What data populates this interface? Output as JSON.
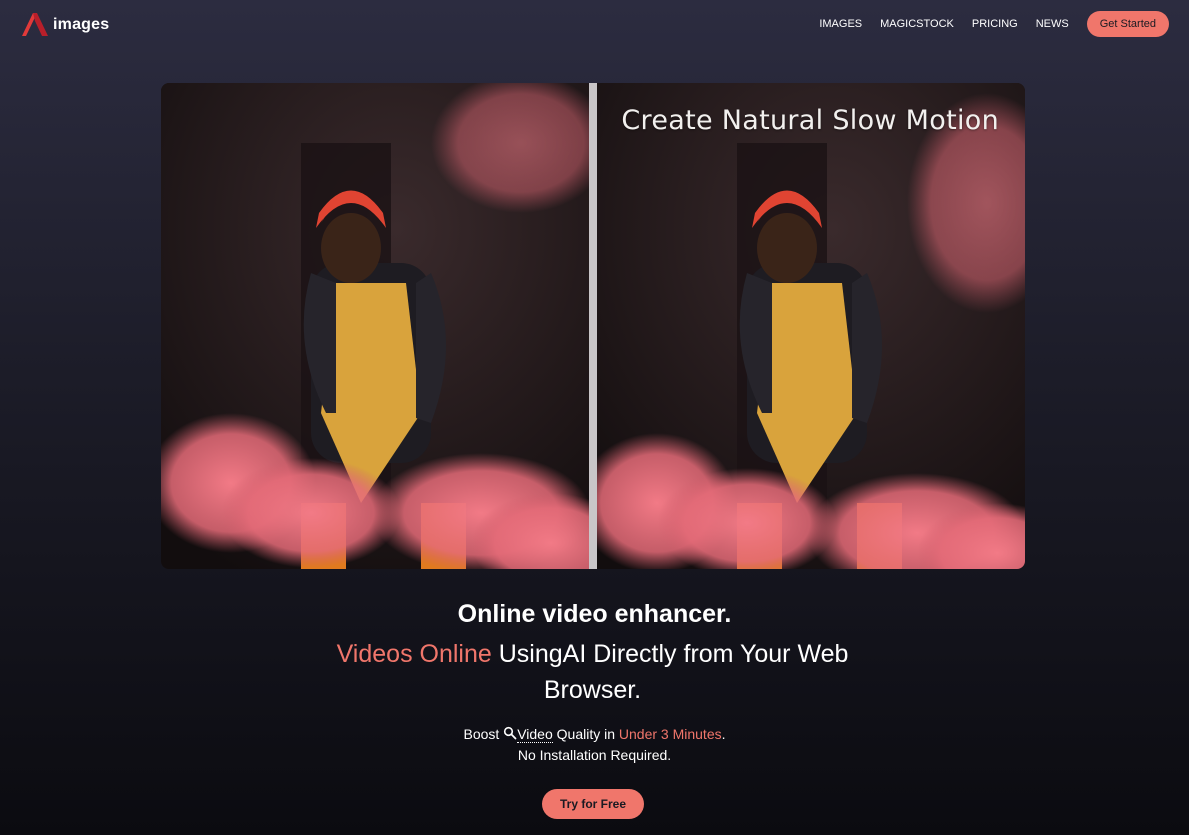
{
  "brand": {
    "logo_text": "images",
    "logo_icon": "brand-logo-icon",
    "accent_color": "#f0766b"
  },
  "nav": {
    "items": [
      {
        "label": "IMAGES"
      },
      {
        "label": "MAGICSTOCK"
      },
      {
        "label": "PRICING"
      },
      {
        "label": "NEWS"
      }
    ],
    "cta_label": "Get Started"
  },
  "hero": {
    "caption": "Create Natural Slow Motion",
    "left_image": "woman-with-pink-smoke-photo",
    "right_image": "woman-with-pink-smoke-photo"
  },
  "content": {
    "headline": "Online video enhancer.",
    "subhead_accent": "Videos Online",
    "subhead_rest": " UsingAI Directly from Your Web Browser.",
    "blurb_prefix": "Boost ",
    "blurb_link": "Video",
    "blurb_middle": " Quality in ",
    "blurb_accent": "Under 3 Minutes",
    "blurb_end": ".",
    "blurb_line2": "No Installation Required.",
    "search_icon": "search-icon",
    "try_label": "Try for Free"
  }
}
